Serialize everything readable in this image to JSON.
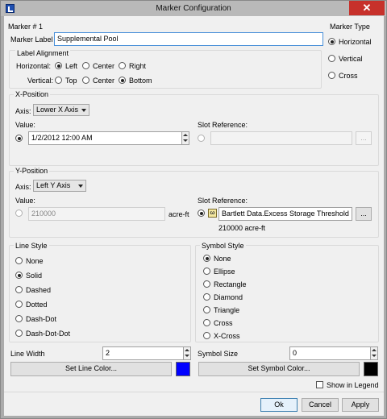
{
  "window": {
    "title": "Marker Configuration",
    "close_glyph": "✕"
  },
  "marker_number": "Marker # 1",
  "marker_label": {
    "label": "Marker Label",
    "value": "Supplemental Pool"
  },
  "label_alignment": {
    "title": "Label Alignment",
    "horizontal_label": "Horizontal:",
    "horizontal_options": [
      "Left",
      "Center",
      "Right"
    ],
    "horizontal_selected": "Left",
    "vertical_label": "Vertical:",
    "vertical_options": [
      "Top",
      "Center",
      "Bottom"
    ],
    "vertical_selected": "Bottom"
  },
  "marker_type": {
    "title": "Marker Type",
    "options": [
      "Horizontal",
      "Vertical",
      "Cross"
    ],
    "selected": "Horizontal"
  },
  "x_position": {
    "title": "X-Position",
    "axis_label": "Axis:",
    "axis_value": "Lower X Axis",
    "value_label": "Value:",
    "value": "1/2/2012 12:00 AM",
    "slot_ref_label": "Slot Reference:",
    "slot_ref_value": "",
    "browse": "..."
  },
  "y_position": {
    "title": "Y-Position",
    "axis_label": "Axis:",
    "axis_value": "Left Y Axis",
    "value_label": "Value:",
    "value": "210000",
    "unit": "acre-ft",
    "slot_ref_label": "Slot Reference:",
    "slot_ref_value": "Bartlett Data.Excess Storage Threshold",
    "slot_icon": "ω",
    "browse": "...",
    "slot_value_readout": "210000  acre-ft"
  },
  "line_style": {
    "title": "Line Style",
    "options": [
      "None",
      "Solid",
      "Dashed",
      "Dotted",
      "Dash-Dot",
      "Dash-Dot-Dot"
    ],
    "selected": "Solid",
    "width_label": "Line Width",
    "width_value": "2",
    "color_button": "Set Line Color...",
    "color": "#0000ff"
  },
  "symbol_style": {
    "title": "Symbol Style",
    "options": [
      "None",
      "Ellipse",
      "Rectangle",
      "Diamond",
      "Triangle",
      "Cross",
      "X-Cross"
    ],
    "selected": "None",
    "size_label": "Symbol Size",
    "size_value": "0",
    "color_button": "Set Symbol Color...",
    "color": "#000000"
  },
  "show_in_legend": {
    "label": "Show in Legend",
    "checked": false
  },
  "buttons": {
    "ok": "Ok",
    "cancel": "Cancel",
    "apply": "Apply"
  }
}
